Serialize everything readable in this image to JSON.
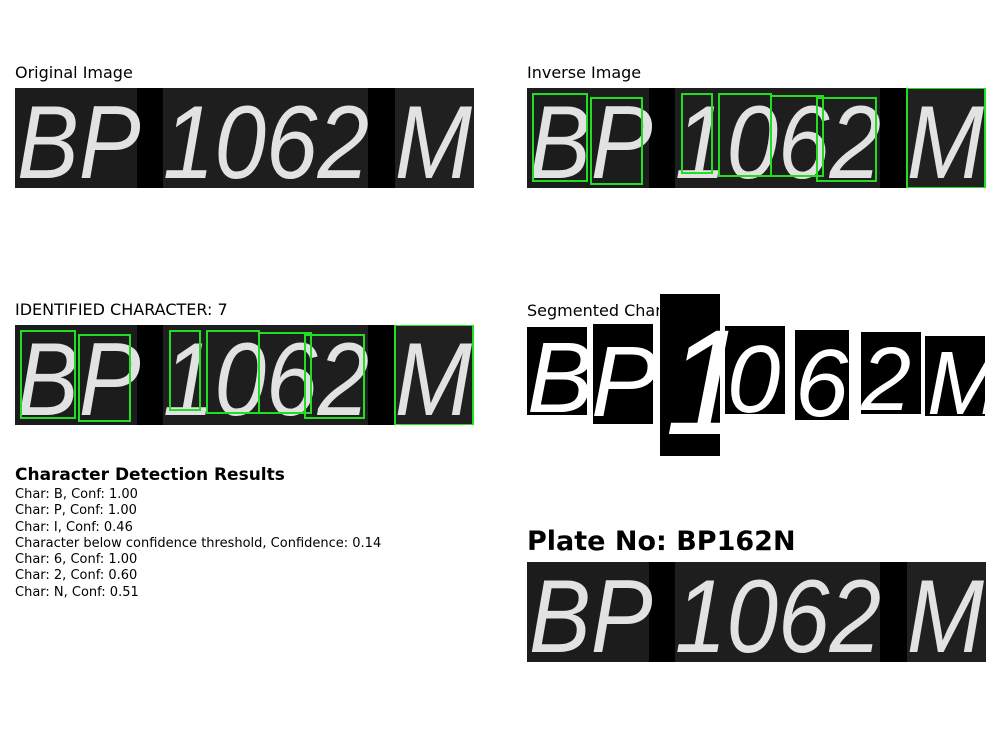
{
  "panels": {
    "original": {
      "title": "Original Image",
      "plate_text": "BP 1062 M"
    },
    "inverse": {
      "title": "Inverse Image",
      "plate_text": "BP 1062 M"
    },
    "identified": {
      "title": "IDENTIFIED CHARACTER: 7",
      "plate_text": "BP 1062 M"
    },
    "segmented": {
      "title": "Segmented Characters",
      "glyphs": [
        "B",
        "P",
        "1",
        "0",
        "6",
        "2",
        "M"
      ]
    },
    "plate": {
      "heading": "Plate No: BP162N",
      "plate_text": "BP 1062 M"
    }
  },
  "results": {
    "title": "Character Detection Results",
    "lines": [
      "Char: B, Conf: 1.00",
      "Char: P, Conf: 1.00",
      "Char: I, Conf: 0.46",
      "Character below confidence threshold, Confidence: 0.14",
      "Char: 6, Conf: 1.00",
      "Char: 2, Conf: 0.60",
      "Char: N, Conf: 0.51"
    ]
  },
  "colors": {
    "box": "#22dd22",
    "plate_bg": "#1a1a1a",
    "glyph": "#e4e4e4"
  }
}
